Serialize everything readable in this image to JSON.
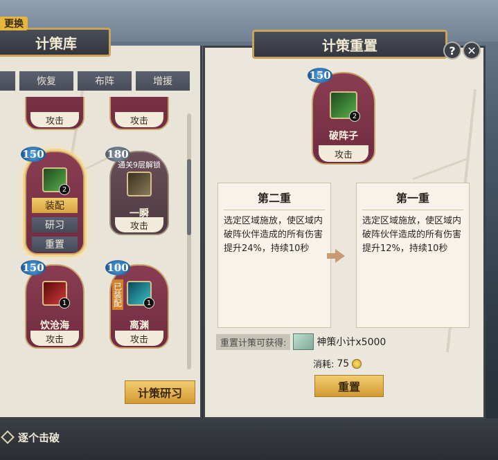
{
  "left_panel": {
    "swap_tag": "更换",
    "title": "计策库",
    "tabs": [
      "",
      "恢复",
      "布阵",
      "增援"
    ],
    "cards": [
      {
        "name": "",
        "foot": "攻击"
      },
      {
        "name": "",
        "foot": "攻击"
      },
      {
        "cost": "150",
        "name": "",
        "count": "2",
        "equip": "装配",
        "study": "研习",
        "reset": "重置",
        "icon_color": "#3d8a3a"
      },
      {
        "cost": "180",
        "name": "一瞬",
        "lock_text": "通关9层解锁",
        "foot": "攻击",
        "icon_color": "#7a6a4a"
      },
      {
        "cost": "150",
        "name": "饮沧海",
        "count": "1",
        "foot": "攻击",
        "icon_color": "#b52a2a"
      },
      {
        "cost": "100",
        "name": "离渊",
        "count": "1",
        "foot": "攻击",
        "equipped_tag": "已装配",
        "icon_color": "#2a8a9a"
      }
    ],
    "study_button": "计策研习",
    "kill_one": "逐个击破"
  },
  "right_panel": {
    "title": "计策重置",
    "help": "?",
    "close": "✕",
    "card": {
      "cost": "150",
      "name": "破阵子",
      "count": "2",
      "foot": "攻击",
      "icon_color": "#3d8a3a"
    },
    "level_from": {
      "title": "第二重",
      "desc": "选定区域施放，使区域内破阵伙伴造成的所有伤害提升24%，持续10秒"
    },
    "level_to": {
      "title": "第一重",
      "desc": "选定区域施放，使区域内破阵伙伴造成的所有伤害提升12%，持续10秒"
    },
    "reward_label": "重置计策可获得:",
    "reward_text": "神策小计x5000",
    "cost_label": "消耗:",
    "cost_value": "75",
    "reset_button": "重置"
  }
}
